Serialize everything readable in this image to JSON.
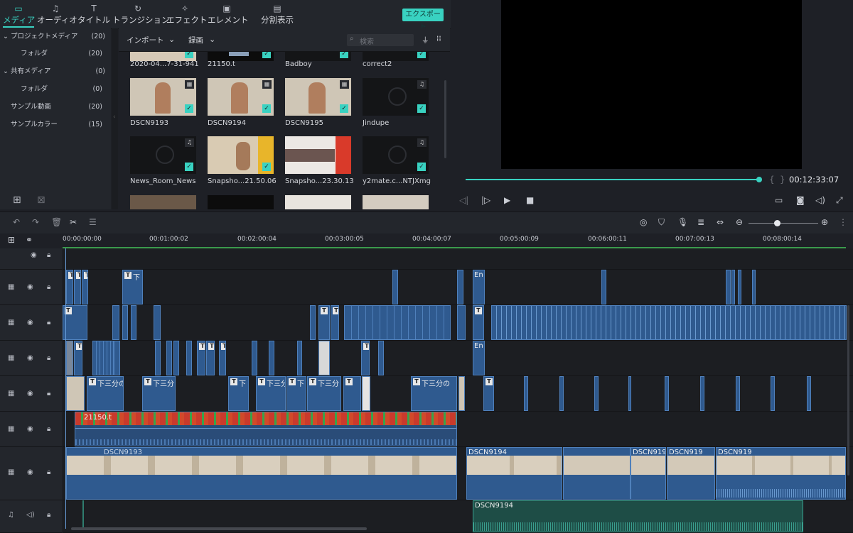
{
  "tabs": [
    {
      "label": "メディア",
      "icon": "folder-icon",
      "active": true
    },
    {
      "label": "オーディオ",
      "icon": "music-note-icon"
    },
    {
      "label": "タイトル",
      "icon": "text-title-icon"
    },
    {
      "label": "トランジション",
      "icon": "transition-icon"
    },
    {
      "label": "エフェクト",
      "icon": "effects-icon"
    },
    {
      "label": "エレメント",
      "icon": "image-icon"
    },
    {
      "label": "分割表示",
      "icon": "split-screen-icon"
    }
  ],
  "export_label": "エクスポート",
  "sidebar": {
    "items": [
      {
        "label": "プロジェクトメディア",
        "count": "(20)",
        "expanded": true
      },
      {
        "label": "フォルダ",
        "count": "(20)"
      },
      {
        "label": "共有メディア",
        "count": "(0)",
        "expanded": true
      },
      {
        "label": "フォルダ",
        "count": "(0)"
      },
      {
        "label": "サンプル動画",
        "count": "(20)"
      },
      {
        "label": "サンプルカラー",
        "count": "(15)"
      }
    ]
  },
  "media_toolbar": {
    "import_label": "インポート",
    "record_label": "録画",
    "search_placeholder": "検索"
  },
  "media": {
    "row1": [
      "2020-04...7-31-941",
      "21150.t",
      "Badboy",
      "correct2"
    ],
    "row2": [
      "DSCN9193",
      "DSCN9194",
      "DSCN9195",
      "Jindupe"
    ],
    "row3": [
      "News_Room_News",
      "Snapsho...21.50.06",
      "Snapsho...23.30.13",
      "y2mate.c...NTJXmg"
    ]
  },
  "preview": {
    "timecode": "00:12:33:07",
    "progress": 0.99
  },
  "ruler": [
    "00:00:00:00",
    "00:01:00:02",
    "00:02:00:04",
    "00:03:00:05",
    "00:04:00:07",
    "00:05:00:09",
    "00:06:00:11",
    "00:07:00:13",
    "00:08:00:14"
  ],
  "timeline": {
    "title_clip_label": "下",
    "title_clip_label2": "下三分",
    "title_clip_label3": "下三分の",
    "en_label": "En",
    "audio_clip_label": "21150.t",
    "video_clip_label": "DSCN9193",
    "video_clip_label2": "DSCN9194",
    "video_clip_label3": "DSCN919",
    "bottom_audio_label": "DSCN9194"
  },
  "colors": {
    "accent": "#39d2c1",
    "clip": "#2f5a8f"
  }
}
